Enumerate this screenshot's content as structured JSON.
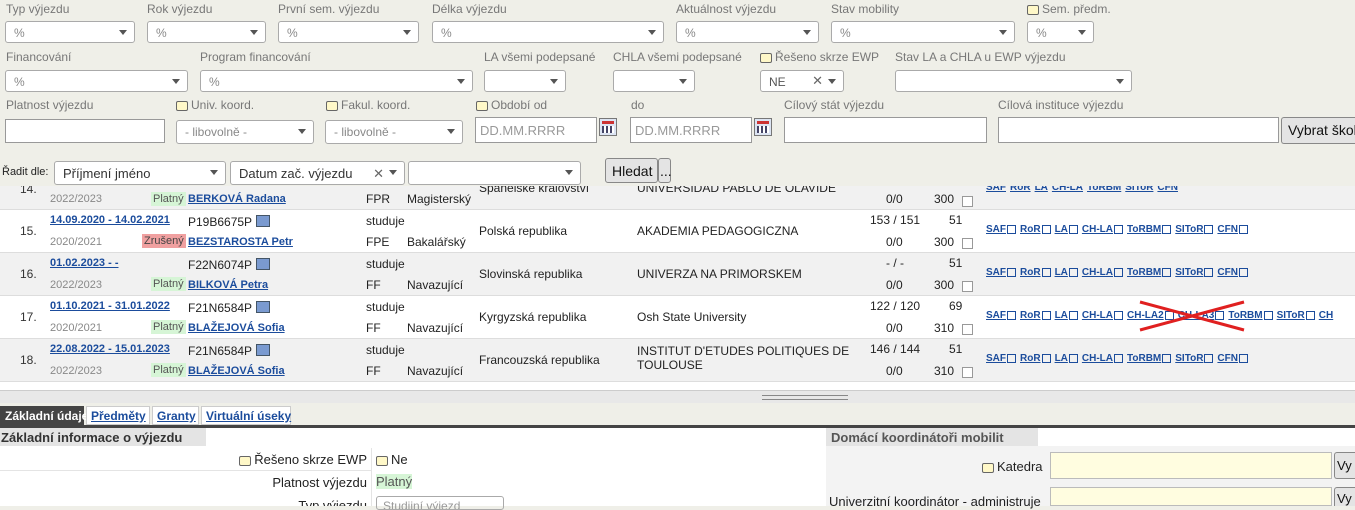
{
  "filters": {
    "row1": [
      {
        "label": "Typ výjezdu",
        "value": "%"
      },
      {
        "label": "Rok výjezdu",
        "value": "%"
      },
      {
        "label": "První sem. výjezdu",
        "value": "%"
      },
      {
        "label": "Délka výjezdu",
        "value": "%"
      },
      {
        "label": "Aktuálnost výjezdu",
        "value": "%"
      },
      {
        "label": "Stav mobility",
        "value": "%"
      },
      {
        "label": "Sem. předm.",
        "value": "%"
      }
    ],
    "row2": [
      {
        "label": "Financování",
        "value": "%"
      },
      {
        "label": "Program financování",
        "value": "%"
      },
      {
        "label": "LA všemi podepsané",
        "value": ""
      },
      {
        "label": "CHLA všemi podepsané",
        "value": ""
      },
      {
        "label": "Řešeno skrze EWP",
        "value": "NE"
      },
      {
        "label": "Stav LA a CHLA u EWP výjezdu",
        "value": ""
      }
    ],
    "row3": {
      "platnost_label": "Platnost výjezdu",
      "univ_label": "Univ. koord.",
      "univ_value": "- libovolně -",
      "fakul_label": "Fakul. koord.",
      "fakul_value": "- libovolně -",
      "obdobi_label": "Období od",
      "obdobi_placeholder": "DD.MM.RRRR",
      "do_label": "do",
      "do_placeholder": "DD.MM.RRRR",
      "stat_label": "Cílový stát výjezdu",
      "inst_label": "Cílová instituce výjezdu",
      "vybrat_label": "Vybrat škol"
    },
    "sort": {
      "label": "Řadit dle:",
      "sort1": "Příjmení jméno",
      "sort2": "Datum zač. výjezdu",
      "sort3": "",
      "search_label": "Hledat",
      "more_label": "..."
    }
  },
  "rows": [
    {
      "num": "14.",
      "date": "",
      "year": "2022/2023",
      "status": "Platný",
      "status_type": "ok",
      "name": "BERKOVÁ Radana",
      "code": "",
      "kind": "",
      "fac": "FPR",
      "level": "Magisterský",
      "country": "Španělské království",
      "inst": "UNIVERSIDAD PABLO DE OLAVIDE",
      "credits": "",
      "credits2": "0/0",
      "days1": "",
      "days2": "300"
    },
    {
      "num": "15.",
      "date": "14.09.2020 - 14.02.2021",
      "year": "2020/2021",
      "status": "Zrušený",
      "status_type": "bad",
      "name": "BEZSTAROSTA Petr",
      "code": "P19B6675P",
      "kind": "studuje",
      "fac": "FPE",
      "level": "Bakalářský",
      "country": "Polská republika",
      "inst": "AKADEMIA PEDAGOGICZNA",
      "credits": "153 / 151",
      "credits2": "0/0",
      "days1": "51",
      "days2": "300"
    },
    {
      "num": "16.",
      "date": "01.02.2023 - -",
      "year": "2022/2023",
      "status": "Platný",
      "status_type": "ok",
      "name": "BILKOVÁ Petra",
      "code": "F22N6074P",
      "kind": "studuje",
      "fac": "FF",
      "level": "Navazující",
      "country": "Slovinská republika",
      "inst": "UNIVERZA NA PRIMORSKEM",
      "credits": "- / -",
      "credits2": "0/0",
      "days1": "51",
      "days2": "300"
    },
    {
      "num": "17.",
      "date": "01.10.2021 - 31.01.2022",
      "year": "2020/2021",
      "status": "Platný",
      "status_type": "ok",
      "name": "BLAŽEJOVÁ Sofia",
      "code": "F21N6584P",
      "kind": "studuje",
      "fac": "FF",
      "level": "Navazující",
      "country": "Kyrgyzská republika",
      "inst": "Osh State University",
      "credits": "122 / 120",
      "credits2": "0/0",
      "days1": "69",
      "days2": "310"
    },
    {
      "num": "18.",
      "date": "22.08.2022 - 15.01.2023",
      "year": "2022/2023",
      "status": "Platný",
      "status_type": "ok",
      "name": "BLAŽEJOVÁ Sofia",
      "code": "F21N6584P",
      "kind": "studuje",
      "fac": "FF",
      "level": "Navazující",
      "country": "Francouzská republika",
      "inst": "INSTITUT D'ETUDES POLITIQUES DE TOULOUSE",
      "credits": "146 / 144",
      "credits2": "0/0",
      "days1": "51",
      "days2": "310"
    }
  ],
  "row_links": [
    "SAF",
    "RoR",
    "LA",
    "CH-LA",
    "ToRBM",
    "SIToR",
    "CFN"
  ],
  "row17_links": [
    "SAF",
    "RoR",
    "LA",
    "CH-LA",
    "CH-LA2",
    "CH-LA3",
    "ToRBM",
    "SIToR",
    "CH"
  ],
  "tabs": [
    "Základní údaje",
    "Předměty",
    "Granty",
    "Virtuální úseky"
  ],
  "detail": {
    "left_header": "Základní informace o výjezdu",
    "ewp_label": "Řešeno skrze EWP",
    "ewp_value": "Ne",
    "platnost_label": "Platnost výjezdu",
    "platnost_value": "Platný",
    "typ_label": "Typ výjezdu",
    "typ_value": "Studijní výjezd",
    "right_header": "Domácí koordinátoři mobilit",
    "katedra_label": "Katedra",
    "univ_label": "Univerzitní koordinátor - administruje",
    "vybrat_label": "Vy"
  },
  "colors": {
    "link": "#1b4c9c",
    "valid_bg": "#d6f5d6",
    "cancelled_bg": "#f0a0a0",
    "tab_active": "#444444"
  }
}
